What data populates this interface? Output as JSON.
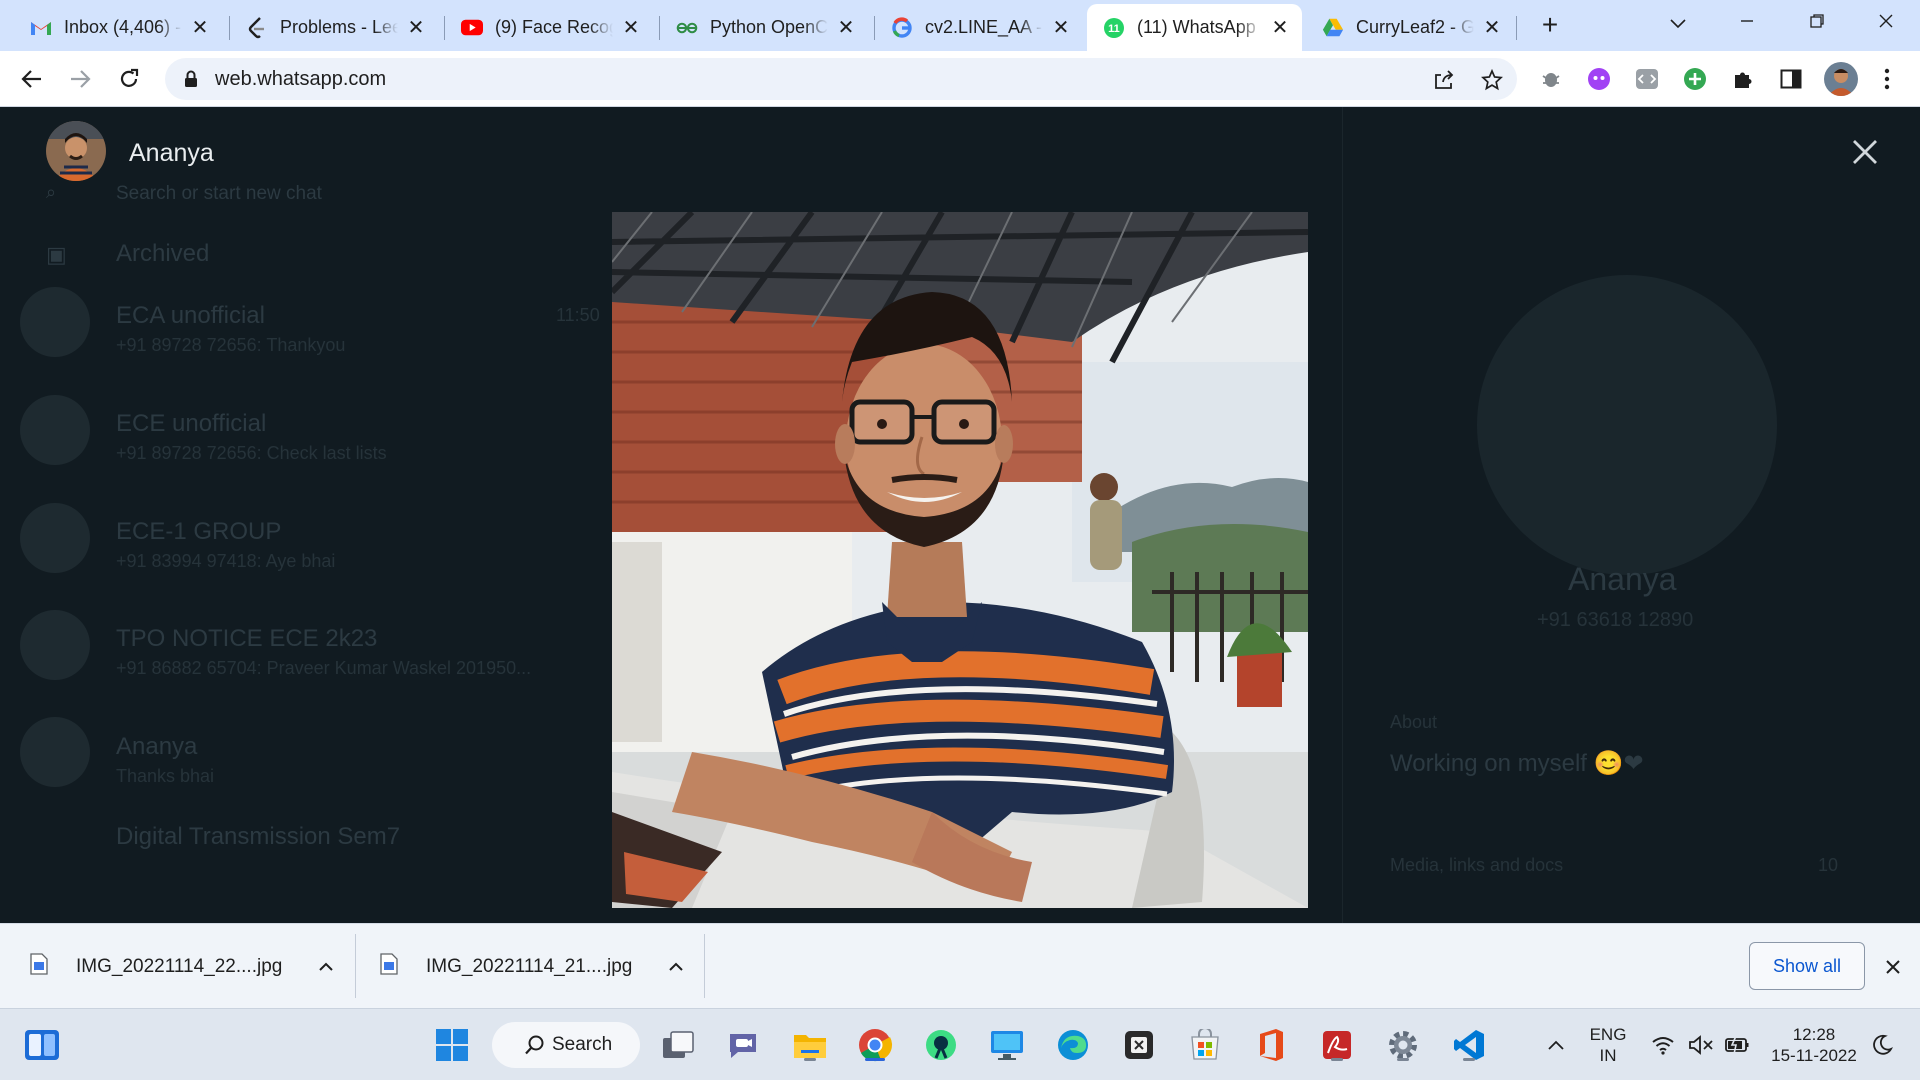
{
  "browser": {
    "tabs": [
      {
        "title": "Inbox (4,406) -",
        "icon": "gmail-icon"
      },
      {
        "title": "Problems - Lee",
        "icon": "leetcode-icon"
      },
      {
        "title": "(9) Face Recogn",
        "icon": "youtube-icon"
      },
      {
        "title": "Python OpenC",
        "icon": "geeksforgeeks-icon"
      },
      {
        "title": "cv2.LINE_AA - (",
        "icon": "google-icon"
      },
      {
        "title": "(11) WhatsApp",
        "icon": "whatsapp-icon",
        "active": true,
        "badge": "11"
      },
      {
        "title": "CurryLeaf2 - G",
        "icon": "google-drive-icon"
      }
    ],
    "url": "web.whatsapp.com"
  },
  "whatsapp_background": {
    "search_placeholder": "Search or start new chat",
    "archived_label": "Archived",
    "chats": [
      {
        "name": "ECA unofficial",
        "preview": "+91 89728 72656: Thankyou",
        "time": "11:50"
      },
      {
        "name": "ECE unofficial",
        "preview": "+91 89728 72656: Check last lists",
        "time": ""
      },
      {
        "name": "ECE-1 GROUP",
        "preview": "+91 83994 97418: Aye bhai",
        "time": ""
      },
      {
        "name": "TPO NOTICE ECE 2k23",
        "preview": "+91 86882 65704: Praveer Kumar Waskel 201950...",
        "time": ""
      },
      {
        "name": "Ananya",
        "preview": "Thanks bhai",
        "time": ""
      },
      {
        "name": "Digital Transmission Sem7",
        "preview": "",
        "time": ""
      }
    ],
    "contact_panel": {
      "name": "Ananya",
      "phone": "+91 63618 12890",
      "about_label": "About",
      "about_text": "Working on myself 😊❤",
      "media_label": "Media, links and docs",
      "media_count": "10"
    }
  },
  "media_viewer": {
    "contact_name": "Ananya",
    "photo_description_icon": "profile-photo"
  },
  "downloads": {
    "items": [
      {
        "filename": "IMG_20221114_22....jpg"
      },
      {
        "filename": "IMG_20221114_21....jpg"
      }
    ],
    "show_all_label": "Show all"
  },
  "taskbar": {
    "search_label": "Search",
    "language_line1": "ENG",
    "language_line2": "IN",
    "time": "12:28",
    "date": "15-11-2022"
  },
  "colors": {
    "tabstrip": "#d3e3fd",
    "whatsapp_bg": "#111b21",
    "accent_blue": "#0b57d0",
    "whatsapp_green": "#25d366"
  }
}
